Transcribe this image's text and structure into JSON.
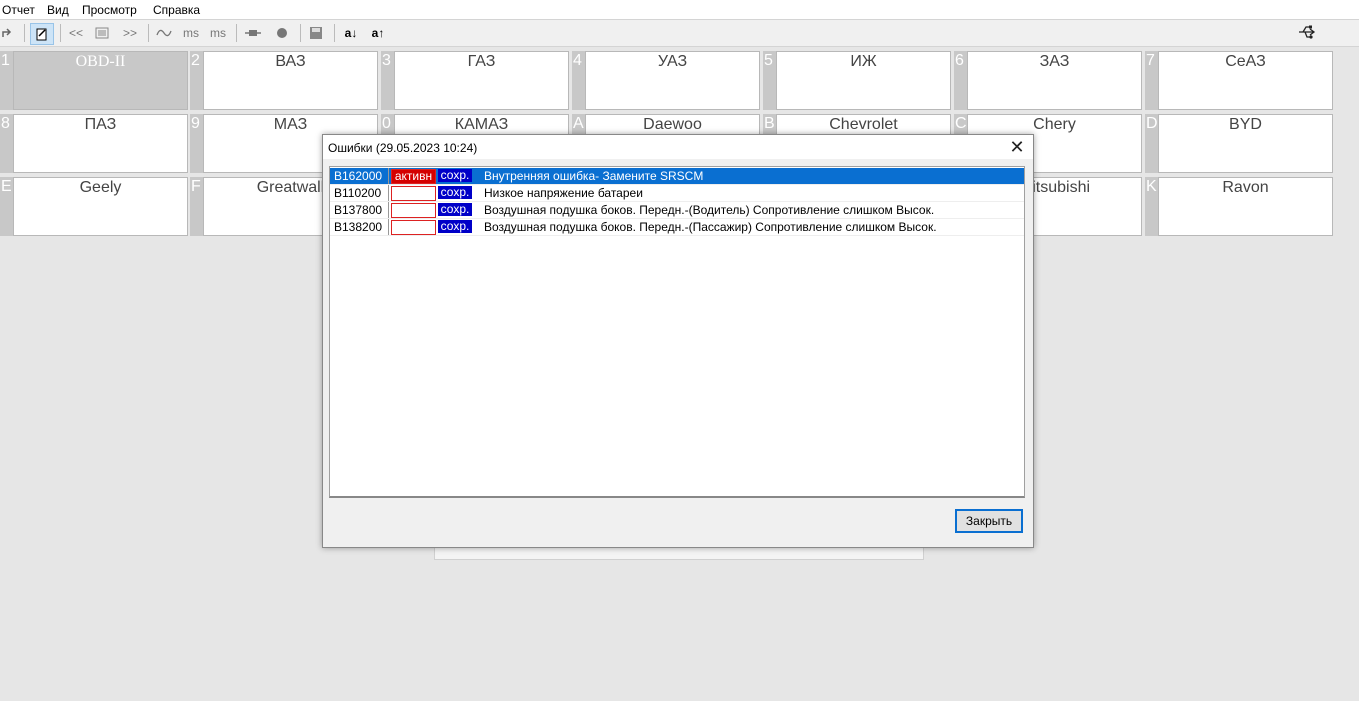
{
  "menu": [
    "Отчет",
    "Вид",
    "Просмотр",
    "Справка"
  ],
  "toolbar": {
    "prev_label": "<<",
    "next_label": ">>",
    "ms_label": "ms",
    "ms_plus_label": "ms",
    "sort_down_label": "a↓",
    "sort_up_label": "a↑"
  },
  "brands": [
    {
      "key": "1",
      "name": "OBD-II",
      "selected": true
    },
    {
      "key": "2",
      "name": "ВАЗ"
    },
    {
      "key": "3",
      "name": "ГАЗ"
    },
    {
      "key": "4",
      "name": "УАЗ"
    },
    {
      "key": "5",
      "name": "ИЖ"
    },
    {
      "key": "6",
      "name": "ЗАЗ"
    },
    {
      "key": "7",
      "name": "СеАЗ"
    },
    {
      "key": "8",
      "name": "ПАЗ"
    },
    {
      "key": "9",
      "name": "МАЗ"
    },
    {
      "key": "0",
      "name": "КАМАЗ"
    },
    {
      "key": "A",
      "name": "Daewoo"
    },
    {
      "key": "B",
      "name": "Chevrolet"
    },
    {
      "key": "C",
      "name": "Chery"
    },
    {
      "key": "D",
      "name": "BYD"
    },
    {
      "key": "E",
      "name": "Geely"
    },
    {
      "key": "F",
      "name": "Greatwall"
    },
    {
      "key": "J",
      "name": "Mitsubishi"
    },
    {
      "key": "K",
      "name": "Ravon"
    }
  ],
  "dialog": {
    "title": "Ошибки (29.05.2023  10:24)",
    "close_label": "Закрыть",
    "errors": [
      {
        "code": "B162000",
        "active": "активн",
        "saved": "сохр.",
        "desc": "Внутренняя ошибка- Замените SRSCM",
        "selected": true
      },
      {
        "code": "B110200",
        "active": "",
        "saved": "сохр.",
        "desc": "Низкое напряжение батареи"
      },
      {
        "code": "B137800",
        "active": "",
        "saved": "сохр.",
        "desc": "Воздушная подушка боков. Передн.-(Водитель) Сопротивление слишком Высок."
      },
      {
        "code": "B138200",
        "active": "",
        "saved": "сохр.",
        "desc": "Воздушная подушка боков. Передн.-(Пассажир) Сопротивление слишком Высок."
      }
    ]
  }
}
